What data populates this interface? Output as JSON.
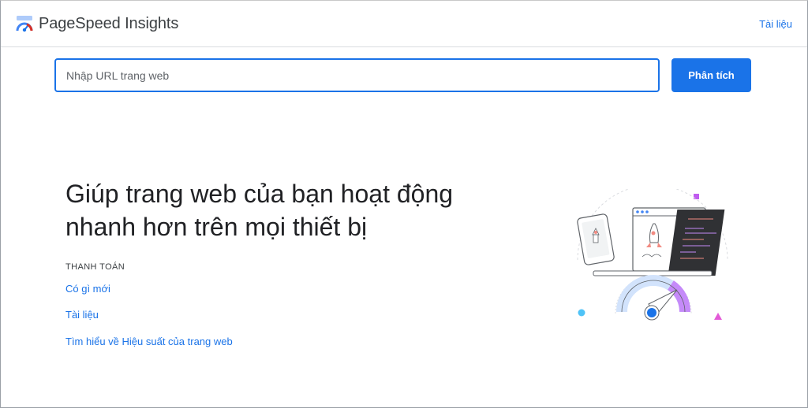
{
  "header": {
    "brand": "PageSpeed Insights",
    "docs_link": "Tài liệu"
  },
  "search": {
    "placeholder": "Nhập URL trang web",
    "value": "",
    "button_label": "Phân tích"
  },
  "hero": {
    "title": "Giúp trang web của bạn hoạt động nhanh hơn trên mọi thiết bị"
  },
  "links_section": {
    "label": "THANH TOÁN",
    "items": [
      {
        "label": "Có gì mới"
      },
      {
        "label": "Tài liệu"
      },
      {
        "label": "Tìm hiểu về Hiệu suất của trang web"
      }
    ]
  },
  "colors": {
    "accent": "#1a73e8",
    "purple": "#c05cf0",
    "pink": "#e35ad7",
    "teal": "#4fc3f7",
    "dark_panel": "#303134"
  },
  "icons": {
    "logo": "pagespeed-gauge-icon"
  }
}
